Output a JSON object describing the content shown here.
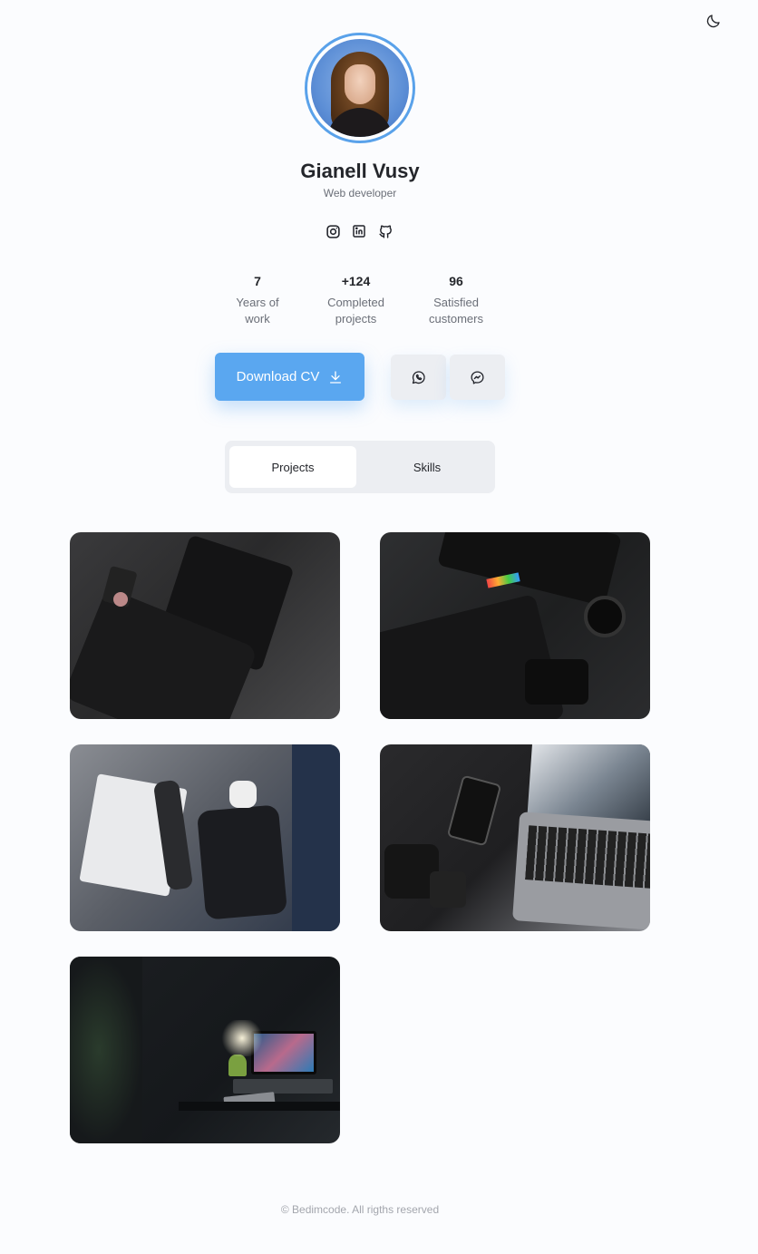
{
  "profile": {
    "name": "Gianell Vusy",
    "role": "Web developer"
  },
  "socials": [
    {
      "icon": "instagram-icon"
    },
    {
      "icon": "linkedin-icon"
    },
    {
      "icon": "github-icon"
    }
  ],
  "stats": [
    {
      "value": "7",
      "label_line1": "Years of",
      "label_line2": "work"
    },
    {
      "value": "+124",
      "label_line1": "Completed",
      "label_line2": "projects"
    },
    {
      "value": "96",
      "label_line1": "Satisfied",
      "label_line2": "customers"
    }
  ],
  "actions": {
    "download_cv": "Download CV"
  },
  "tabs": [
    {
      "label": "Projects",
      "active": true
    },
    {
      "label": "Skills",
      "active": false
    }
  ],
  "footer": "© Bedimcode. All rigths reserved",
  "colors": {
    "accent": "#5aa7f0",
    "text": "#24262b",
    "muted": "#6b6f78"
  }
}
